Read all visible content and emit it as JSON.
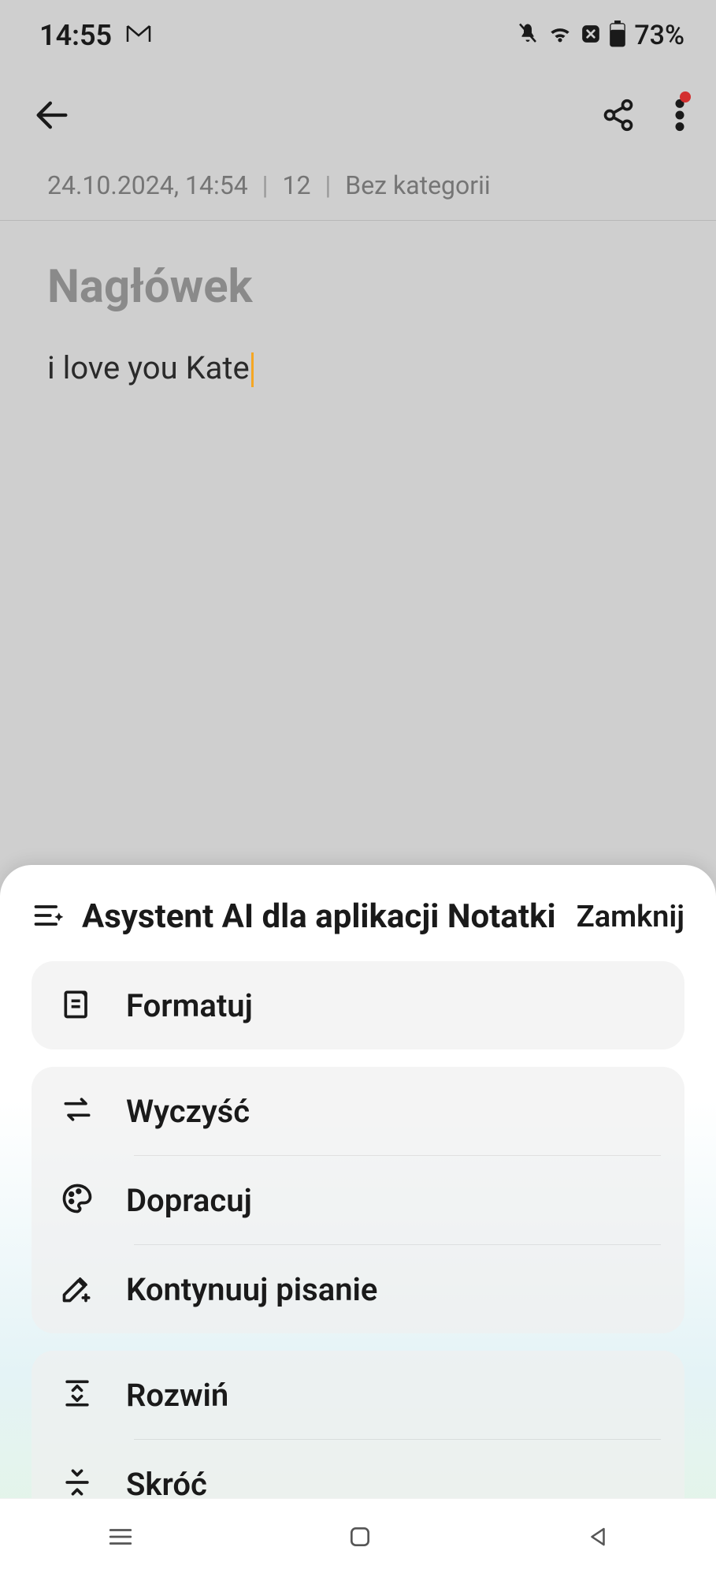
{
  "status": {
    "time": "14:55",
    "battery": "73%"
  },
  "note": {
    "date": "24.10.2024, 14:54",
    "char_count": "12",
    "category": "Bez kategorii",
    "title_placeholder": "Nagłówek",
    "body": "i love you Kate"
  },
  "sheet": {
    "title": "Asystent AI dla aplikacji Notatki",
    "close": "Zamknij",
    "actions": {
      "format": "Formatuj",
      "clear": "Wyczyść",
      "refine": "Dopracuj",
      "continue": "Kontynuuj pisanie",
      "expand": "Rozwiń",
      "shorten": "Skróć"
    }
  }
}
